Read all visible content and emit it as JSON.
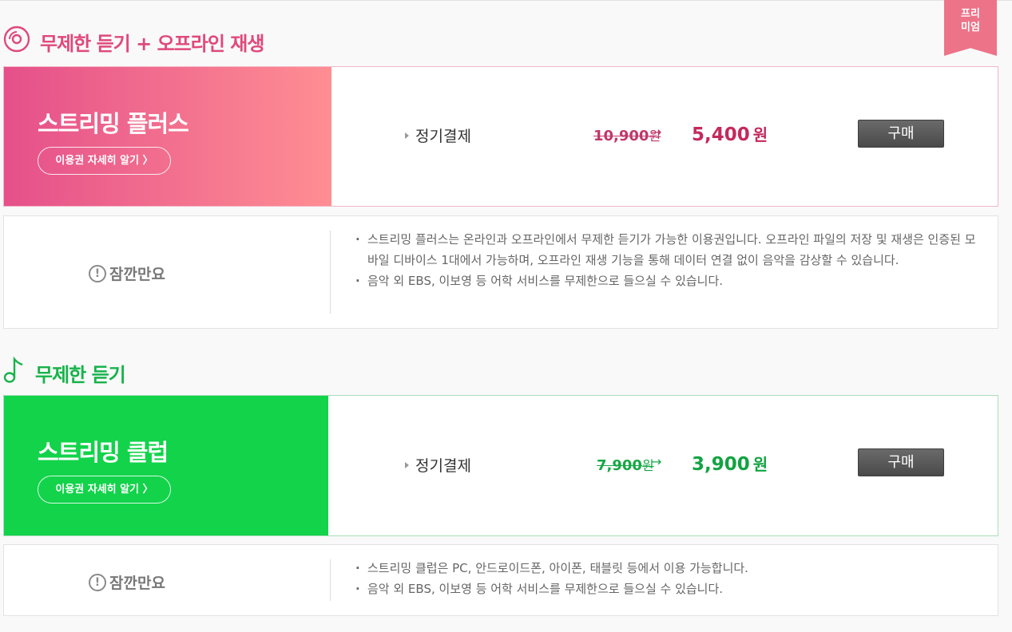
{
  "ribbon": {
    "line1": "프리",
    "line2": "미엄"
  },
  "sections": [
    {
      "title": "무제한 듣기 + 오프라인 재생",
      "icon": "disc-icon",
      "product": {
        "name": "스트리밍 플러스",
        "detail_label": "이용권 자세히 알기 〉",
        "plan": "정기결제",
        "old_price": "10,900",
        "old_unit": "원",
        "arrow": "→",
        "new_price": "5,400",
        "new_unit": "원",
        "buy_label": "구매"
      },
      "notice": {
        "title": "잠깐만요",
        "items": [
          "스트리밍 플러스는 온라인과 오프라인에서 무제한 듣기가 가능한 이용권입니다. 오프라인 파일의 저장 및 재생은 인증된 모바일 디바이스 1대에서 가능하며, 오프라인 재생 기능을 통해 데이터 연결 없이 음악을 감상할 수 있습니다.",
          "음악 외 EBS, 이보영 등 어학 서비스를 무제한으로 들으실 수 있습니다."
        ]
      }
    },
    {
      "title": "무제한 듣기",
      "icon": "music-note-icon",
      "product": {
        "name": "스트리밍 클럽",
        "detail_label": "이용권 자세히 알기 〉",
        "plan": "정기결제",
        "old_price": "7,900",
        "old_unit": "원",
        "arrow": "→",
        "new_price": "3,900",
        "new_unit": "원",
        "buy_label": "구매"
      },
      "notice": {
        "title": "잠깐만요",
        "items": [
          "스트리밍 클럽은 PC, 안드로이드폰, 아이폰, 태블릿 등에서 이용 가능합니다.",
          "음악 외 EBS, 이보영 등 어학 서비스를 무제한으로 들으실 수 있습니다."
        ]
      }
    }
  ],
  "colors": {
    "pink": "#e0497b",
    "green": "#17b34a",
    "button": "#555555"
  }
}
